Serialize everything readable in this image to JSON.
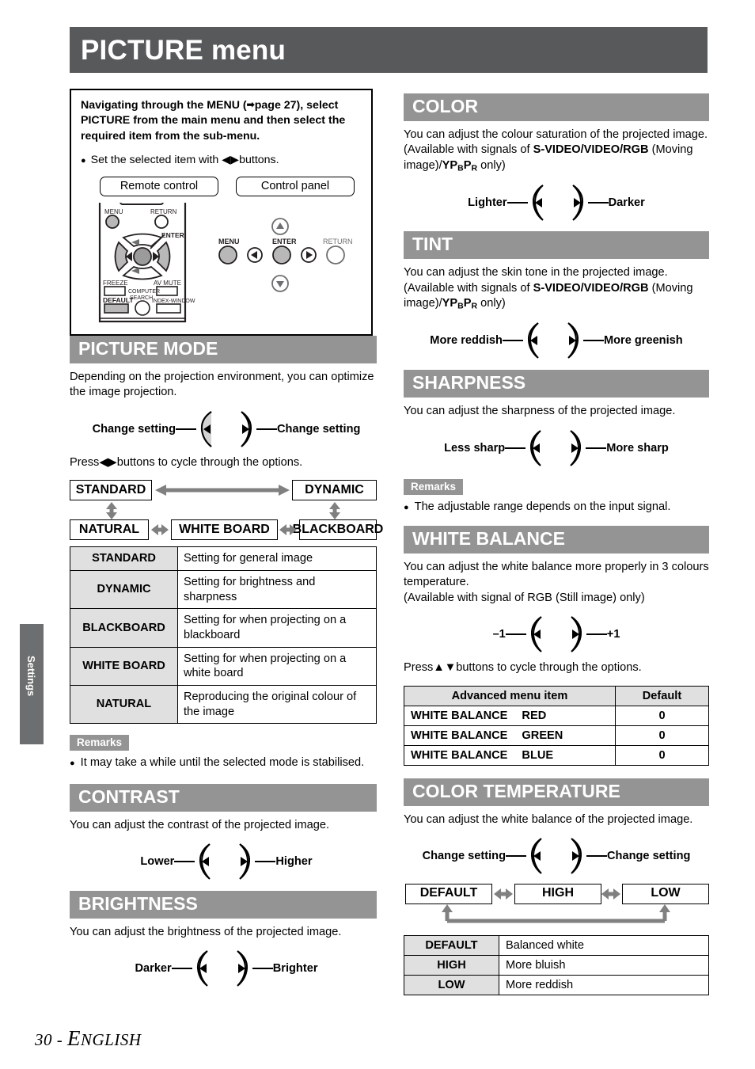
{
  "page": {
    "title": "PICTURE menu",
    "side_tab": "Settings",
    "footer_page": "30 - ",
    "footer_lang_cap": "E",
    "footer_lang_rest": "NGLISH"
  },
  "nav_box": {
    "lead_part1": "Navigating through the MENU (",
    "lead_arrow": "➡",
    "lead_part2": "page 27), select PICTURE from the main menu and then select the required item from the sub-menu.",
    "bullet_dot": "●",
    "bullet_text_1": "Set the selected item with ",
    "bullet_arrows": "◀▶",
    "bullet_text_2": "buttons.",
    "pill_remote": "Remote control",
    "pill_panel": "Control panel",
    "remote_labels": {
      "menu": "MENU",
      "return": "RETURN",
      "enter": "ENTER",
      "freeze": "FREEZE",
      "av_mute": "AV MUTE",
      "computer_search": "COMPUTER SEARCH",
      "default": "DEFAULT",
      "index_window": "INDEX-WINDOW"
    },
    "panel_labels": {
      "menu": "MENU",
      "enter": "ENTER",
      "return": "RETURN"
    }
  },
  "sections": {
    "picture_mode": {
      "heading": "PICTURE MODE",
      "description": "Depending on the projection environment, you can optimize the image projection.",
      "adjust_left": "Change setting",
      "adjust_right": "Change setting",
      "press_text_1": "Press",
      "press_arrows": "◀▶",
      "press_text_2": "buttons to cycle through the options.",
      "flow": {
        "standard": "STANDARD",
        "dynamic": "DYNAMIC",
        "natural": "NATURAL",
        "white_board": "WHITE BOARD",
        "blackboard": "BLACKBOARD"
      },
      "table": [
        {
          "key": "STANDARD",
          "desc": "Setting for general image"
        },
        {
          "key": "DYNAMIC",
          "desc": "Setting for brightness and sharpness"
        },
        {
          "key": "BLACKBOARD",
          "desc": "Setting for when projecting on a blackboard"
        },
        {
          "key": "WHITE BOARD",
          "desc": "Setting for when projecting on a white board"
        },
        {
          "key": "NATURAL",
          "desc": "Reproducing the original colour of the image"
        }
      ],
      "remarks_label": "Remarks",
      "remarks": [
        "It may take a while until the selected mode is stabilised."
      ]
    },
    "contrast": {
      "heading": "CONTRAST",
      "description": "You can adjust the contrast of the projected image.",
      "adjust_left": "Lower",
      "adjust_right": "Higher"
    },
    "brightness": {
      "heading": "BRIGHTNESS",
      "description": "You can adjust the brightness of the projected image.",
      "adjust_left": "Darker",
      "adjust_right": "Brighter"
    },
    "color": {
      "heading": "COLOR",
      "desc_1": "You can adjust the colour saturation of the projected image. (Available with signals of ",
      "desc_b1": "S-VIDEO/VIDEO/",
      "desc_b2": "RGB",
      "desc_2": " (Moving image)/",
      "desc_yp": "YP",
      "desc_yp_b": "B",
      "desc_yp_p": "P",
      "desc_yp_r": "R",
      "desc_3": " only)",
      "adjust_left": "Lighter",
      "adjust_right": "Darker"
    },
    "tint": {
      "heading": "TINT",
      "desc_1": "You can adjust the skin tone in the projected image. (Available with signals of ",
      "desc_b1": "S-VIDEO/VIDEO/RGB",
      "desc_2": " (Moving image)/",
      "desc_3": " only)",
      "adjust_left": "More reddish",
      "adjust_right": "More greenish"
    },
    "sharpness": {
      "heading": "SHARPNESS",
      "description": "You can adjust the sharpness of the projected image.",
      "adjust_left": "Less sharp",
      "adjust_right": "More sharp",
      "remarks_label": "Remarks",
      "remarks": [
        "The adjustable range depends on the input signal."
      ]
    },
    "white_balance": {
      "heading": "WHITE BALANCE",
      "description": "You can adjust the white balance more properly in 3 colours temperature.\n(Available with signal of RGB (Still image) only)",
      "adjust_left": "–1",
      "adjust_right": "+1",
      "press_text_1": "Press",
      "press_arrows": "▲▼",
      "press_text_2": "buttons to cycle through the options.",
      "table_headers": [
        "Advanced menu item",
        "Default"
      ],
      "table": [
        {
          "item": "WHITE BALANCE",
          "sub": "RED",
          "default": "0"
        },
        {
          "item": "WHITE BALANCE",
          "sub": "GREEN",
          "default": "0"
        },
        {
          "item": "WHITE BALANCE",
          "sub": "BLUE",
          "default": "0"
        }
      ]
    },
    "color_temperature": {
      "heading": "COLOR TEMPERATURE",
      "description": "You can adjust the white balance of the projected image.",
      "adjust_left": "Change setting",
      "adjust_right": "Change setting",
      "flow": {
        "default": "DEFAULT",
        "high": "HIGH",
        "low": "LOW"
      },
      "table": [
        {
          "key": "DEFAULT",
          "desc": "Balanced white"
        },
        {
          "key": "HIGH",
          "desc": "More bluish"
        },
        {
          "key": "LOW",
          "desc": "More reddish"
        }
      ]
    }
  },
  "colors": {
    "title_bar": "#58595b",
    "section_header": "#949494",
    "table_key_bg": "#e0e0e0",
    "flow_arrow": "#808080",
    "petal_fill": "#d4d4d4"
  }
}
